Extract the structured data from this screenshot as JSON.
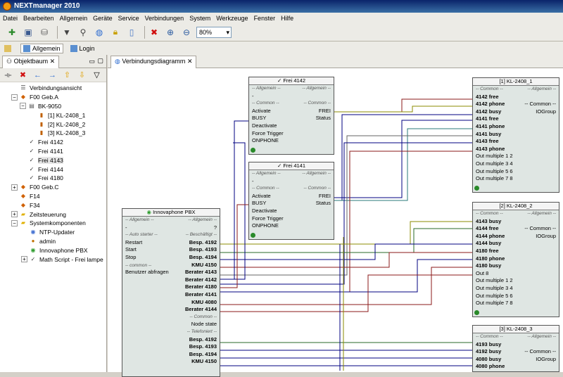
{
  "window": {
    "title": "NEXTmanager 2010"
  },
  "menu": [
    "Datei",
    "Bearbeiten",
    "Allgemein",
    "Geräte",
    "Service",
    "Verbindungen",
    "System",
    "Werkzeuge",
    "Fenster",
    "Hilfe"
  ],
  "toolbar": {
    "zoom": "80%"
  },
  "viewtabs": {
    "allgemein": "Allgemein",
    "login": "Login"
  },
  "left": {
    "tab": "Objektbaum",
    "tree": [
      {
        "label": "Verbindungsansicht"
      },
      {
        "label": "F00 Geb.A"
      },
      {
        "label": "BK-9050"
      },
      {
        "label": "[1] KL-2408_1"
      },
      {
        "label": "[2] KL-2408_2"
      },
      {
        "label": "[3] KL-2408_3"
      },
      {
        "label": "Frei 4142"
      },
      {
        "label": "Frei 4141"
      },
      {
        "label": "Frei 4143"
      },
      {
        "label": "Frei 4144"
      },
      {
        "label": "Frei 4180"
      },
      {
        "label": "F00 Geb.C"
      },
      {
        "label": "F14"
      },
      {
        "label": "F34"
      },
      {
        "label": "Zeitsteuerung"
      },
      {
        "label": "Systemkomponenten"
      },
      {
        "label": "NTP-Updater"
      },
      {
        "label": "admin"
      },
      {
        "label": "Innovaphone PBX"
      },
      {
        "label": "Math Script - Frei lampe"
      }
    ]
  },
  "main": {
    "tab": "Verbindungsdiagramm"
  },
  "nodes": {
    "frei4142": {
      "title": "Frei 4142",
      "sec_allg": "-- Allgemein --",
      "dash": "-",
      "sec_common": "-- Common --",
      "in": [
        "Activate",
        "BUSY",
        "Deactivate",
        "Force Trigger",
        "ONPHONE"
      ],
      "out": [
        "FREI",
        "Status"
      ]
    },
    "frei4141": {
      "title": "Frei 4141",
      "sec_allg": "-- Allgemein --",
      "dash": "-",
      "sec_common": "-- Common --",
      "in": [
        "Activate",
        "BUSY",
        "Deactivate",
        "Force Trigger",
        "ONPHONE"
      ],
      "out": [
        "FREI",
        "Status"
      ]
    },
    "pbx": {
      "title": "Innovaphone PBX",
      "sec_allg": "-- Allgemein --",
      "q": "?",
      "sec_auto": "-- Auto starter --",
      "sec_besch": "-- Beschäftigt --",
      "in": [
        "Restart",
        "Start",
        "Stop",
        "-- common --",
        "Benutzer abfragen"
      ],
      "out": [
        "Besp. 4192",
        "Besp. 4193",
        "Besp. 4194",
        "KMU 4150",
        "Berater 4143",
        "Berater 4142",
        "Berater 4180",
        "Berater 4141",
        "KMU 4080",
        "Berater 4144",
        "-- Common --",
        "Node state",
        "-- Telefoniert --",
        "Besp. 4192",
        "Besp. 4193",
        "Besp. 4194",
        "KMU 4150"
      ]
    },
    "kl1": {
      "title": "[1] KL-2408_1",
      "sec_common": "-- Common --",
      "sec_allg": "-- Allgemein --",
      "group": "IOGroup",
      "rows": [
        "4142 free",
        "4142 phone",
        "4142 busy",
        "4141 free",
        "4141 phone",
        "4141 busy",
        "4143 free",
        "4143 phone",
        "Out multiple 1 2",
        "Out multiple 3 4",
        "Out multiple 5 6",
        "Out multiple 7 8"
      ]
    },
    "kl2": {
      "title": "[2] KL-2408_2",
      "sec_common": "-- Common --",
      "sec_allg": "-- Allgemein --",
      "group": "IOGroup",
      "rows": [
        "4143 busy",
        "4144 free",
        "4144 phone",
        "4144 busy",
        "4180 free",
        "4180 phone",
        "4180 busy",
        "Out 8",
        "Out multiple 1 2",
        "Out multiple 3 4",
        "Out multiple 5 6",
        "Out multiple 7 8"
      ]
    },
    "kl3": {
      "title": "[3] KL-2408_3",
      "sec_common": "-- Common --",
      "sec_allg": "-- Allgemein --",
      "group": "IOGroup",
      "rows": [
        "4193 busy",
        "4192 busy",
        "4080 busy",
        "4080 phone"
      ]
    }
  }
}
